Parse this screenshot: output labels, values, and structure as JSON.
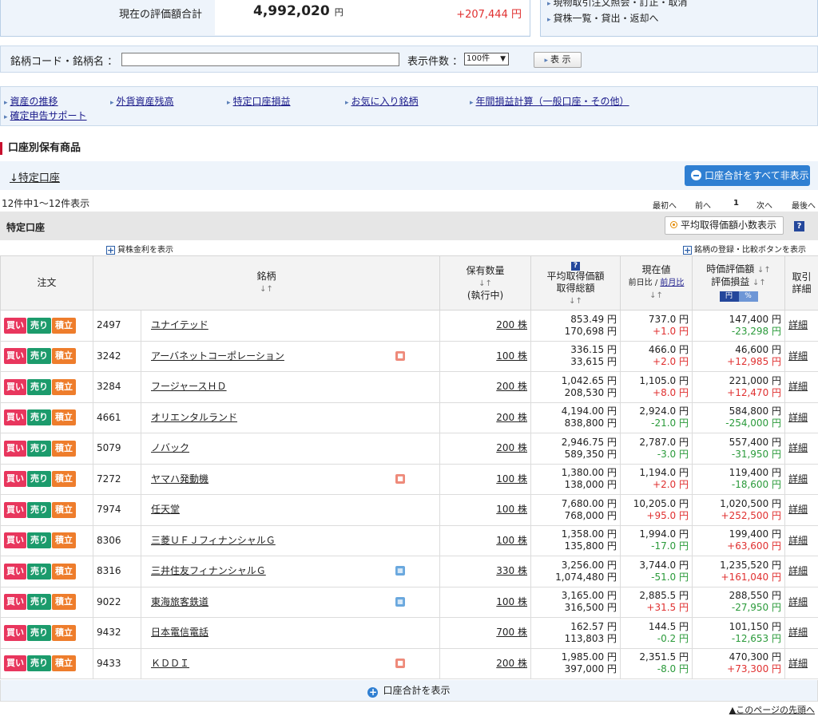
{
  "summary": {
    "label": "現在の評価額合計",
    "amount": "4,992,020",
    "unit": "円",
    "gain": "+207,444 円"
  },
  "side_links": [
    "現物取引注文照会・訂正・取消",
    "貸株一覧・貸出・返却へ"
  ],
  "search": {
    "code_label": "銘柄コード・銘柄名 ：",
    "code_value": "",
    "count_label": "表示件数 ：",
    "count_value": "100件",
    "show_label": "表 示"
  },
  "links": [
    "資産の推移",
    "外貨資産残高",
    "特定口座損益",
    "お気に入り銘柄",
    "年間損益計算（一般口座・その他）",
    "確定申告サポート"
  ],
  "section": {
    "title": "口座別保有商品",
    "anchor": "↓特定口座",
    "hide_all": "口座合計をすべて非表示",
    "count_text": "12件中1～12件表示",
    "pager": {
      "first": "最初へ",
      "prev": "前へ",
      "page": "1",
      "next": "次へ",
      "last": "最後へ"
    },
    "account": "特定口座",
    "avg_toggle": "平均取得価額小数表示",
    "lending_rate": "貸株金利を表示",
    "compare": "銘柄の登録・比較ボタンを表示",
    "show_total": "口座合計を表示",
    "to_top": "▲このページの先頭へ"
  },
  "headers": {
    "order": "注文",
    "name": "銘柄",
    "qty1": "保有数量",
    "qty2": "(執行中)",
    "avg1": "平均取得価額",
    "avg2": "取得総額",
    "cur1": "現在値",
    "cur2a": "前日比",
    "cur2b": "前月比",
    "val1": "時価評価額",
    "val2": "評価損益",
    "toggle_yen": "円",
    "toggle_pct": "%",
    "detail1": "取引",
    "detail2": "詳細"
  },
  "btn_labels": {
    "buy": "買い",
    "sell": "売り",
    "accum": "積立",
    "detail": "詳細"
  },
  "rows": [
    {
      "code": "2497",
      "name": "ユナイテッド",
      "icon": "",
      "qty": "200 株",
      "avg": "853.49 円",
      "cost": "170,698 円",
      "price": "737.0 円",
      "chg": "+1.0 円",
      "val": "147,400 円",
      "pl": "-23,298 円"
    },
    {
      "code": "3242",
      "name": "アーバネットコーポレーション",
      "icon": "red",
      "qty": "100 株",
      "avg": "336.15 円",
      "cost": "33,615 円",
      "price": "466.0 円",
      "chg": "+2.0 円",
      "val": "46,600 円",
      "pl": "+12,985 円"
    },
    {
      "code": "3284",
      "name": "フージャースＨＤ",
      "icon": "",
      "qty": "200 株",
      "avg": "1,042.65 円",
      "cost": "208,530 円",
      "price": "1,105.0 円",
      "chg": "+8.0 円",
      "val": "221,000 円",
      "pl": "+12,470 円"
    },
    {
      "code": "4661",
      "name": "オリエンタルランド",
      "icon": "",
      "qty": "200 株",
      "avg": "4,194.00 円",
      "cost": "838,800 円",
      "price": "2,924.0 円",
      "chg": "-21.0 円",
      "val": "584,800 円",
      "pl": "-254,000 円"
    },
    {
      "code": "5079",
      "name": "ノバック",
      "icon": "",
      "qty": "200 株",
      "avg": "2,946.75 円",
      "cost": "589,350 円",
      "price": "2,787.0 円",
      "chg": "-3.0 円",
      "val": "557,400 円",
      "pl": "-31,950 円"
    },
    {
      "code": "7272",
      "name": "ヤマハ発動機",
      "icon": "red",
      "qty": "100 株",
      "avg": "1,380.00 円",
      "cost": "138,000 円",
      "price": "1,194.0 円",
      "chg": "+2.0 円",
      "val": "119,400 円",
      "pl": "-18,600 円"
    },
    {
      "code": "7974",
      "name": "任天堂",
      "icon": "",
      "qty": "100 株",
      "avg": "7,680.00 円",
      "cost": "768,000 円",
      "price": "10,205.0 円",
      "chg": "+95.0 円",
      "val": "1,020,500 円",
      "pl": "+252,500 円"
    },
    {
      "code": "8306",
      "name": "三菱ＵＦＪフィナンシャルＧ",
      "icon": "",
      "qty": "100 株",
      "avg": "1,358.00 円",
      "cost": "135,800 円",
      "price": "1,994.0 円",
      "chg": "-17.0 円",
      "val": "199,400 円",
      "pl": "+63,600 円"
    },
    {
      "code": "8316",
      "name": "三井住友フィナンシャルＧ",
      "icon": "blue",
      "qty": "330 株",
      "avg": "3,256.00 円",
      "cost": "1,074,480 円",
      "price": "3,744.0 円",
      "chg": "-51.0 円",
      "val": "1,235,520 円",
      "pl": "+161,040 円"
    },
    {
      "code": "9022",
      "name": "東海旅客鉄道",
      "icon": "blue",
      "qty": "100 株",
      "avg": "3,165.00 円",
      "cost": "316,500 円",
      "price": "2,885.5 円",
      "chg": "+31.5 円",
      "val": "288,550 円",
      "pl": "-27,950 円"
    },
    {
      "code": "9432",
      "name": "日本電信電話",
      "icon": "",
      "qty": "700 株",
      "avg": "162.57 円",
      "cost": "113,803 円",
      "price": "144.5 円",
      "chg": "-0.2 円",
      "val": "101,150 円",
      "pl": "-12,653 円"
    },
    {
      "code": "9433",
      "name": "ＫＤＤＩ",
      "icon": "red",
      "qty": "200 株",
      "avg": "1,985.00 円",
      "cost": "397,000 円",
      "price": "2,351.5 円",
      "chg": "-8.0 円",
      "val": "470,300 円",
      "pl": "+73,300 円"
    }
  ]
}
